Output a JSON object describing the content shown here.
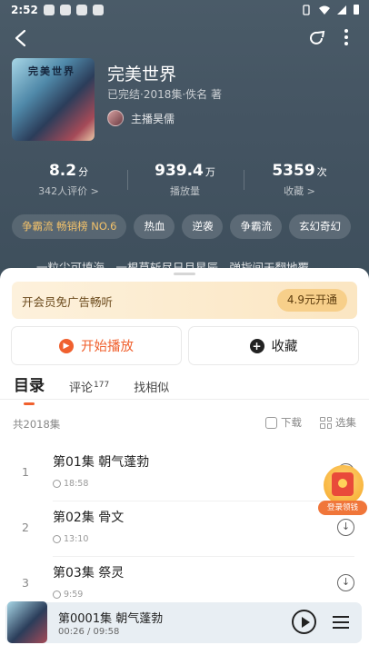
{
  "status_bar": {
    "time": "2:52"
  },
  "book": {
    "title": "完美世界",
    "meta": "已完结·2018集·佚名 著",
    "anchor": "主播昊儒",
    "cover_text": "完美世界"
  },
  "stats": [
    {
      "value": "8.2",
      "unit": "分",
      "label": "342人评价 >"
    },
    {
      "value": "939.4",
      "unit": "万",
      "label": "播放量"
    },
    {
      "value": "5359",
      "unit": "次",
      "label": "收藏 >"
    }
  ],
  "tags": [
    "争霸流 畅销榜 NO.6",
    "热血",
    "逆袭",
    "争霸流",
    "玄幻奇幻"
  ],
  "description": "一粒尘可填海，一根草斩尽日月星辰，弹指间天翻地覆。",
  "vip": {
    "text": "开会员免广告畅听",
    "button": "4.9元开通"
  },
  "actions": {
    "play": "开始播放",
    "favorite": "收藏"
  },
  "tabs": [
    {
      "label": "目录",
      "badge": ""
    },
    {
      "label": "评论",
      "badge": "177"
    },
    {
      "label": "找相似",
      "badge": ""
    }
  ],
  "list": {
    "count_label": "共2018集",
    "download": "下载",
    "select": "选集",
    "episodes": [
      {
        "num": "1",
        "name": "第01集 朝气蓬勃",
        "duration": "18:58"
      },
      {
        "num": "2",
        "name": "第02集 骨文",
        "duration": "13:10"
      },
      {
        "num": "3",
        "name": "第03集 祭灵",
        "duration": "9:59"
      }
    ]
  },
  "promo": {
    "label": "登录领钱"
  },
  "player": {
    "title": "第0001集 朝气蓬勃",
    "time": "00:26 / 09:58"
  },
  "colors": {
    "accent": "#f0602e",
    "gold": "#f3c26a",
    "hero_bg": "#445462"
  }
}
